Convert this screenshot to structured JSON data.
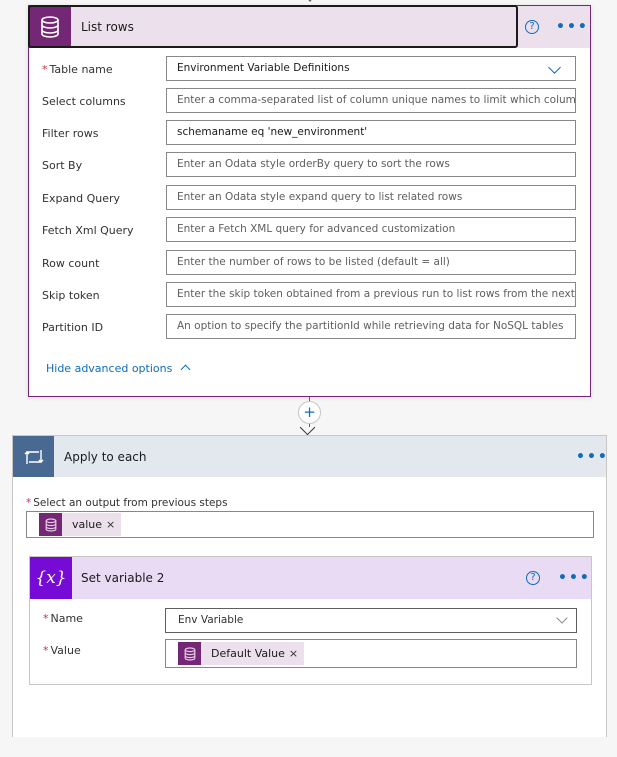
{
  "list_rows": {
    "title": "List rows",
    "icon": "database-icon",
    "help_icon": "?",
    "more_icon": "•••",
    "fields": [
      {
        "label": "Table name",
        "required": true,
        "value": "Environment Variable Definitions",
        "placeholder": "",
        "type": "dropdown"
      },
      {
        "label": "Select columns",
        "required": false,
        "value": "",
        "placeholder": "Enter a comma-separated list of column unique names to limit which columns"
      },
      {
        "label": "Filter rows",
        "required": false,
        "value": "schemaname  eq 'new_environment'",
        "placeholder": ""
      },
      {
        "label": "Sort By",
        "required": false,
        "value": "",
        "placeholder": "Enter an Odata style orderBy query to sort the rows"
      },
      {
        "label": "Expand Query",
        "required": false,
        "value": "",
        "placeholder": "Enter an Odata style expand query to list related rows"
      },
      {
        "label": "Fetch Xml Query",
        "required": false,
        "value": "",
        "placeholder": "Enter a Fetch XML query for advanced customization"
      },
      {
        "label": "Row count",
        "required": false,
        "value": "",
        "placeholder": "Enter the number of rows to be listed (default = all)"
      },
      {
        "label": "Skip token",
        "required": false,
        "value": "",
        "placeholder": "Enter the skip token obtained from a previous run to list rows from the next pa"
      },
      {
        "label": "Partition ID",
        "required": false,
        "value": "",
        "placeholder": "An option to specify the partitionId while retrieving data for NoSQL tables"
      }
    ],
    "hide_advanced_label": "Hide advanced options"
  },
  "connector": {
    "plus": "+"
  },
  "apply_to_each": {
    "title": "Apply to each",
    "icon": "loop-icon",
    "more_icon": "•••",
    "select_label": "Select an output from previous steps",
    "required_mark": "*",
    "token": {
      "label": "value",
      "remove": "×",
      "icon": "database-icon"
    }
  },
  "set_variable": {
    "title": "Set variable 2",
    "icon_text": "{x}",
    "help_icon": "?",
    "more_icon": "•••",
    "name_label": "Name",
    "name_value": "Env Variable",
    "value_label": "Value",
    "value_token": {
      "label": "Default Value",
      "remove": "×",
      "icon": "database-icon"
    },
    "required_mark": "*"
  },
  "colors": {
    "dataverse_purple": "#742774",
    "loop_blue": "#486991",
    "variable_purple": "#770bd6",
    "link_blue": "#0f6cbd",
    "required_red": "#c4314b"
  }
}
